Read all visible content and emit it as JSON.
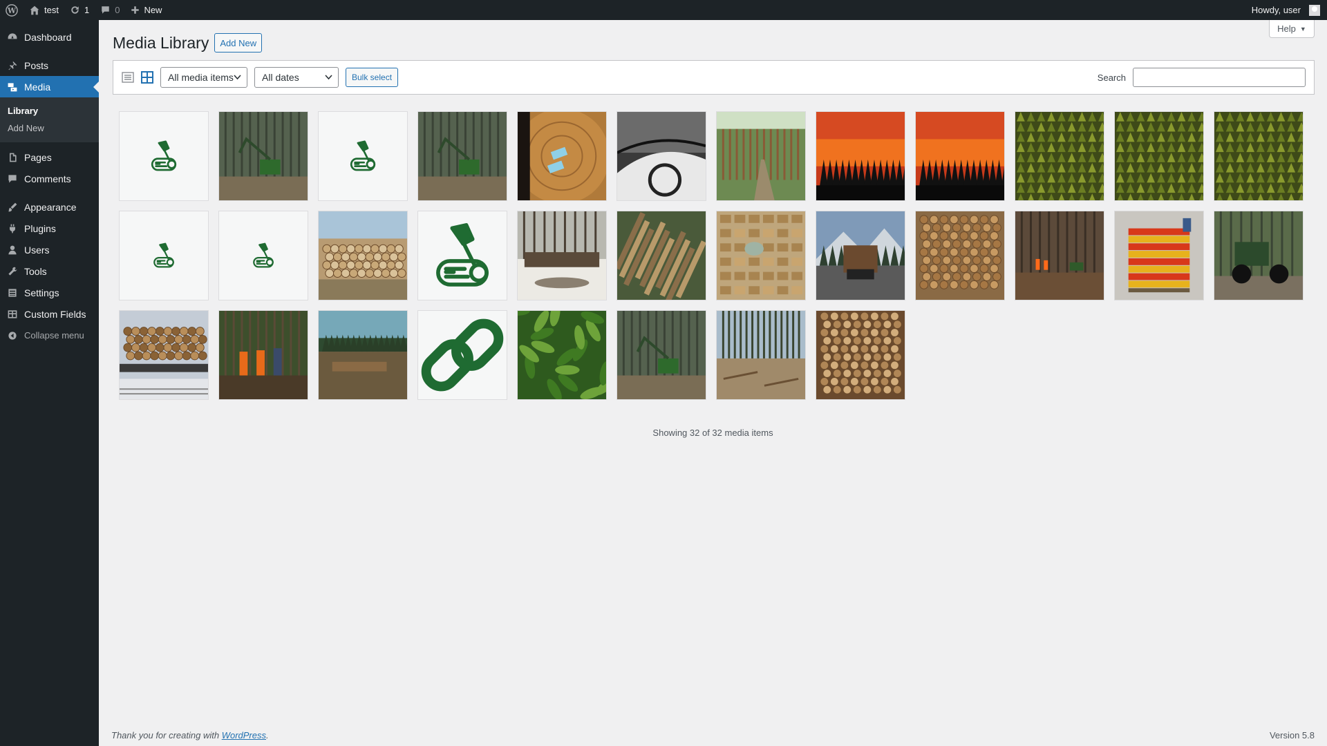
{
  "adminbar": {
    "site_name": "test",
    "updates_count": "1",
    "comments_count": "0",
    "new_label": "New",
    "howdy": "Howdy, user"
  },
  "sidebar": {
    "items": [
      {
        "label": "Dashboard",
        "icon": "dashboard-icon"
      },
      {
        "label": "Posts",
        "icon": "pin-icon"
      },
      {
        "label": "Media",
        "icon": "media-icon"
      },
      {
        "label": "Pages",
        "icon": "page-icon"
      },
      {
        "label": "Comments",
        "icon": "comment-icon"
      },
      {
        "label": "Appearance",
        "icon": "brush-icon"
      },
      {
        "label": "Plugins",
        "icon": "plug-icon"
      },
      {
        "label": "Users",
        "icon": "user-icon"
      },
      {
        "label": "Tools",
        "icon": "wrench-icon"
      },
      {
        "label": "Settings",
        "icon": "settings-icon"
      },
      {
        "label": "Custom Fields",
        "icon": "grid-icon"
      }
    ],
    "submenu": {
      "library": "Library",
      "add_new": "Add New"
    },
    "collapse": "Collapse menu"
  },
  "help": "Help",
  "header": {
    "title": "Media Library",
    "add_new": "Add New"
  },
  "toolbar": {
    "media_filter": "All media items",
    "date_filter": "All dates",
    "bulk_select": "Bulk select",
    "search_label": "Search"
  },
  "status": "Showing 32 of 32 media items",
  "footer": {
    "thanks_prefix": "Thank you for creating with ",
    "link": "WordPress",
    "suffix": ".",
    "version": "Version 5.8"
  },
  "accent_color": "#2271b1",
  "media": [
    {
      "kind": "logo-icon"
    },
    {
      "kind": "harvester-photo"
    },
    {
      "kind": "logo-icon"
    },
    {
      "kind": "harvester-photo"
    },
    {
      "kind": "log-tags-photo"
    },
    {
      "kind": "chainsaw-photo"
    },
    {
      "kind": "forest-path-photo"
    },
    {
      "kind": "sunset-photo"
    },
    {
      "kind": "sunset-photo"
    },
    {
      "kind": "forest-aerial-photo"
    },
    {
      "kind": "forest-aerial-photo"
    },
    {
      "kind": "forest-aerial-photo"
    },
    {
      "kind": "logo-icon-small"
    },
    {
      "kind": "logo-icon-small"
    },
    {
      "kind": "log-pile-photo"
    },
    {
      "kind": "logo-large"
    },
    {
      "kind": "snow-logs-photo"
    },
    {
      "kind": "aerial-logs-photo"
    },
    {
      "kind": "lumber-yard-photo"
    },
    {
      "kind": "log-truck-photo"
    },
    {
      "kind": "firewood-photo"
    },
    {
      "kind": "workers-forest-photo"
    },
    {
      "kind": "pallet-bags-photo"
    },
    {
      "kind": "forwarder-photo"
    },
    {
      "kind": "rail-logs-photo"
    },
    {
      "kind": "forest-workers-photo"
    },
    {
      "kind": "clearing-photo"
    },
    {
      "kind": "link-icon"
    },
    {
      "kind": "foliage-photo"
    },
    {
      "kind": "harvester-photo"
    },
    {
      "kind": "clearcut-photo"
    },
    {
      "kind": "wood-stack-photo"
    }
  ]
}
